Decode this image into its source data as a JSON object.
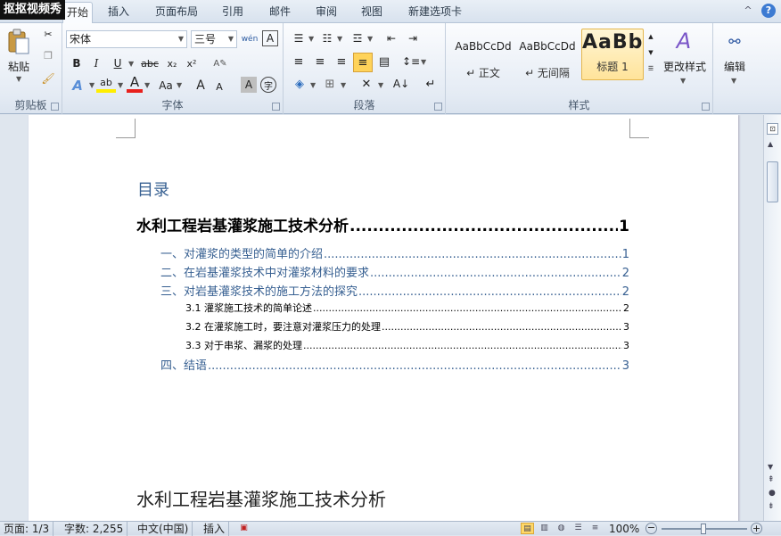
{
  "watermark": "抠抠视频秀",
  "tabs": {
    "home": "开始",
    "insert": "插入",
    "page_layout": "页面布局",
    "references": "引用",
    "mailings": "邮件",
    "review": "审阅",
    "view": "视图",
    "new_tab": "新建选项卡"
  },
  "window": {
    "help": "?",
    "collapse": "^"
  },
  "ribbon": {
    "clipboard": {
      "paste": "粘贴",
      "label": "剪贴板"
    },
    "font": {
      "name": "宋体",
      "size": "三号",
      "bold": "B",
      "italic": "I",
      "underline": "U",
      "strike": "abc",
      "subscript": "x₂",
      "superscript": "x²",
      "grow": "A",
      "shrink": "A",
      "change_case": "Aa",
      "highlight": "ab",
      "font_color": "A",
      "char_shading": "A",
      "enclose": "字",
      "phonetic": "wén",
      "label": "字体"
    },
    "paragraph": {
      "label": "段落"
    },
    "styles": {
      "label": "样式",
      "items": [
        {
          "sample": "AaBbCcDd",
          "name": "↵ 正文"
        },
        {
          "sample": "AaBbCcDd",
          "name": "↵ 无间隔"
        },
        {
          "sample": "AaBb",
          "name": "标题 1"
        }
      ],
      "change_styles": "更改样式"
    },
    "editing": {
      "label": "编辑"
    }
  },
  "document": {
    "toc_heading": "目录",
    "toc": [
      {
        "level": 1,
        "text": "水利工程岩基灌浆施工技术分析",
        "page": "1"
      },
      {
        "level": 2,
        "text": "一、对灌浆的类型的简单的介绍",
        "page": "1"
      },
      {
        "level": 2,
        "text": "二、在岩基灌浆技术中对灌浆材料的要求",
        "page": "2"
      },
      {
        "level": 2,
        "text": "三、对岩基灌浆技术的施工方法的探究",
        "page": "2"
      },
      {
        "level": 3,
        "text": "3.1 灌浆施工技术的简单论述",
        "page": "2"
      },
      {
        "level": 3,
        "text": "3.2 在灌浆施工时，要注意对灌浆压力的处理",
        "page": "3"
      },
      {
        "level": 3,
        "text": "3.3 对于串浆、漏浆的处理",
        "page": "3"
      },
      {
        "level": 2,
        "text": "四、结语",
        "page": "3"
      }
    ],
    "body_title": "水利工程岩基灌浆施工技术分析"
  },
  "status": {
    "page": "页面: 1/3",
    "words": "字数: 2,255",
    "language": "中文(中国)",
    "mode": "插入",
    "zoom": "100%",
    "zoom_out": "−",
    "zoom_in": "+"
  }
}
